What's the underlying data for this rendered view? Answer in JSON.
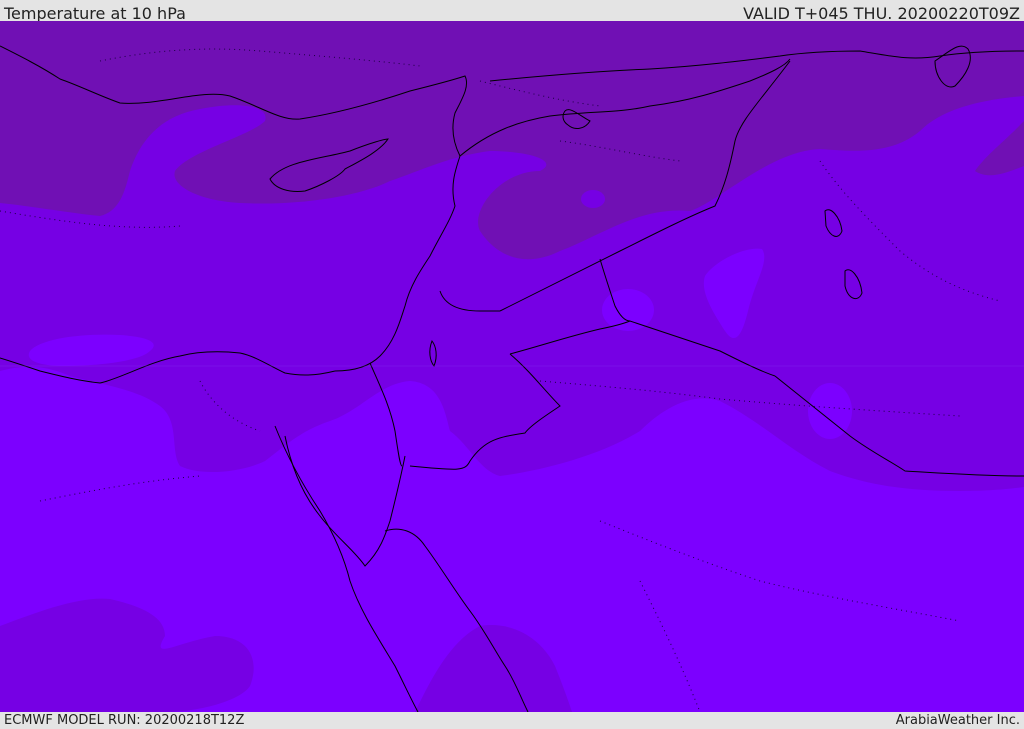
{
  "header": {
    "title": "Temperature at 10 hPa",
    "valid": "VALID T+045 THU. 20200220T09Z"
  },
  "footer": {
    "model_run": "ECMWF MODEL RUN: 20200218T12Z",
    "credit": "ArabiaWeather Inc."
  },
  "map": {
    "palette": {
      "band_dark": "#7010b4",
      "band_mid": "#7600e4",
      "band_light": "#7c00ff",
      "coastline": "#000000",
      "border": "#000000"
    }
  }
}
